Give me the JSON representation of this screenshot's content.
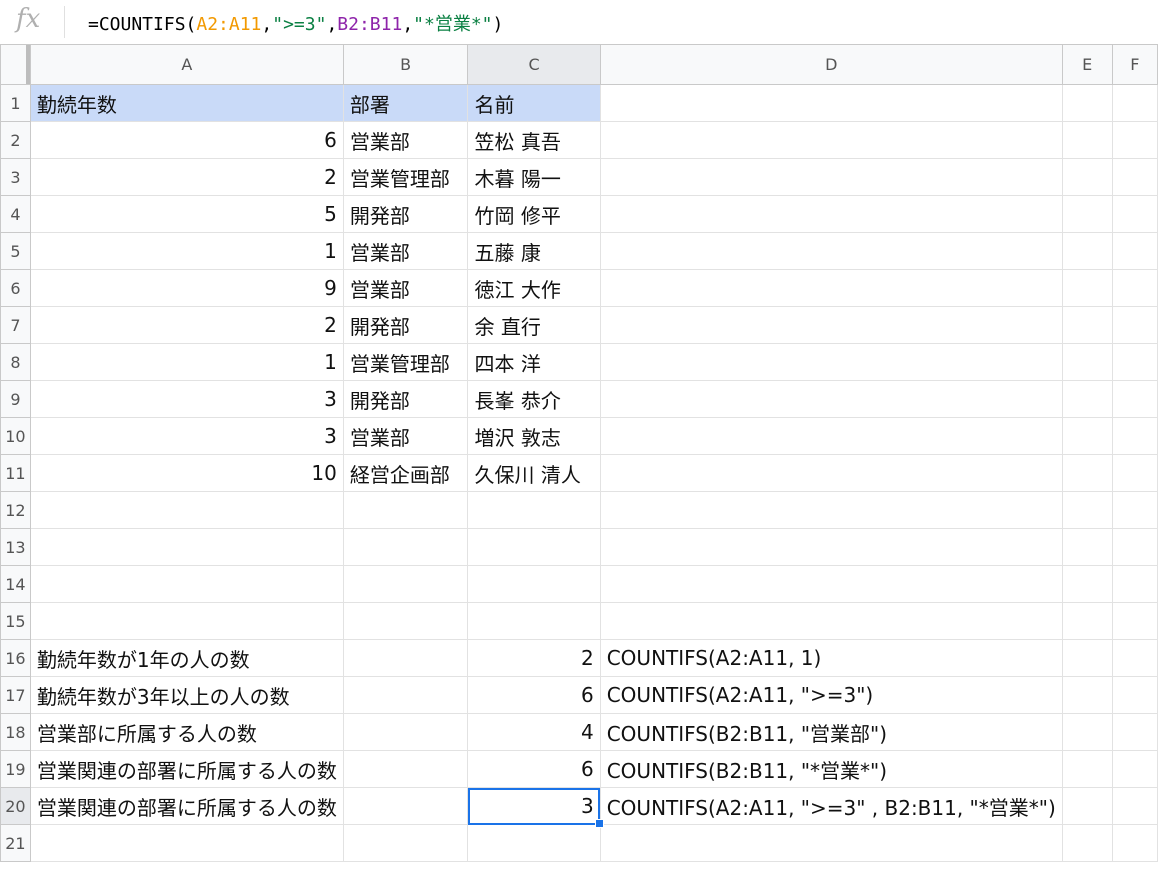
{
  "formula_bar": {
    "fx_label": "fx",
    "formula_parts": [
      {
        "text": "=COUNTIFS(",
        "color": "#000000"
      },
      {
        "text": "A2:A11",
        "color": "#f29900"
      },
      {
        "text": ",",
        "color": "#000000"
      },
      {
        "text": "\">=3\"",
        "color": "#0b8043"
      },
      {
        "text": ",",
        "color": "#000000"
      },
      {
        "text": "B2:B11",
        "color": "#8e24aa"
      },
      {
        "text": ",",
        "color": "#000000"
      },
      {
        "text": "\"*営業*\"",
        "color": "#0b8043"
      },
      {
        "text": ")",
        "color": "#000000"
      }
    ]
  },
  "columns": [
    "A",
    "B",
    "C",
    "D",
    "E",
    "F"
  ],
  "rows": [
    {
      "num": "1",
      "A": "勤続年数",
      "B": "部署",
      "C": "名前",
      "D": "",
      "header": true
    },
    {
      "num": "2",
      "A": "6",
      "B": "営業部",
      "C": "笠松 真吾",
      "D": ""
    },
    {
      "num": "3",
      "A": "2",
      "B": "営業管理部",
      "C": "木暮 陽一",
      "D": ""
    },
    {
      "num": "4",
      "A": "5",
      "B": "開発部",
      "C": "竹岡 修平",
      "D": ""
    },
    {
      "num": "5",
      "A": "1",
      "B": "営業部",
      "C": "五藤 康",
      "D": ""
    },
    {
      "num": "6",
      "A": "9",
      "B": "営業部",
      "C": "徳江 大作",
      "D": ""
    },
    {
      "num": "7",
      "A": "2",
      "B": "開発部",
      "C": "余 直行",
      "D": ""
    },
    {
      "num": "8",
      "A": "1",
      "B": "営業管理部",
      "C": "四本 洋",
      "D": ""
    },
    {
      "num": "9",
      "A": "3",
      "B": "開発部",
      "C": "長峯 恭介",
      "D": ""
    },
    {
      "num": "10",
      "A": "3",
      "B": "営業部",
      "C": "増沢 敦志",
      "D": ""
    },
    {
      "num": "11",
      "A": "10",
      "B": "経営企画部",
      "C": "久保川 清人",
      "D": ""
    },
    {
      "num": "12",
      "A": "",
      "B": "",
      "C": "",
      "D": ""
    },
    {
      "num": "13",
      "A": "",
      "B": "",
      "C": "",
      "D": ""
    },
    {
      "num": "14",
      "A": "",
      "B": "",
      "C": "",
      "D": ""
    },
    {
      "num": "15",
      "A": "",
      "B": "",
      "C": "",
      "D": ""
    },
    {
      "num": "16",
      "A": "勤続年数が1年の人の数",
      "B": "",
      "C": "2",
      "D": "COUNTIFS(A2:A11, 1)"
    },
    {
      "num": "17",
      "A": "勤続年数が3年以上の人の数",
      "B": "",
      "C": "6",
      "D": "COUNTIFS(A2:A11, \">=3\")"
    },
    {
      "num": "18",
      "A": "営業部に所属する人の数",
      "B": "",
      "C": "4",
      "D": "COUNTIFS(B2:B11, \"営業部\")"
    },
    {
      "num": "19",
      "A": "営業関連の部署に所属する人の数",
      "B": "",
      "C": "6",
      "D": "COUNTIFS(B2:B11, \"*営業*\")"
    },
    {
      "num": "20",
      "A": "営業関連の部署に所属する人の数",
      "B": "",
      "C": "3",
      "D": "COUNTIFS(A2:A11, \">=3\" , B2:B11, \"*営業*\")"
    },
    {
      "num": "21",
      "A": "",
      "B": "",
      "C": "",
      "D": ""
    }
  ],
  "selected_cell": "C20",
  "colors": {
    "header_fill": "#c9daf8",
    "selection": "#1a73e8"
  }
}
